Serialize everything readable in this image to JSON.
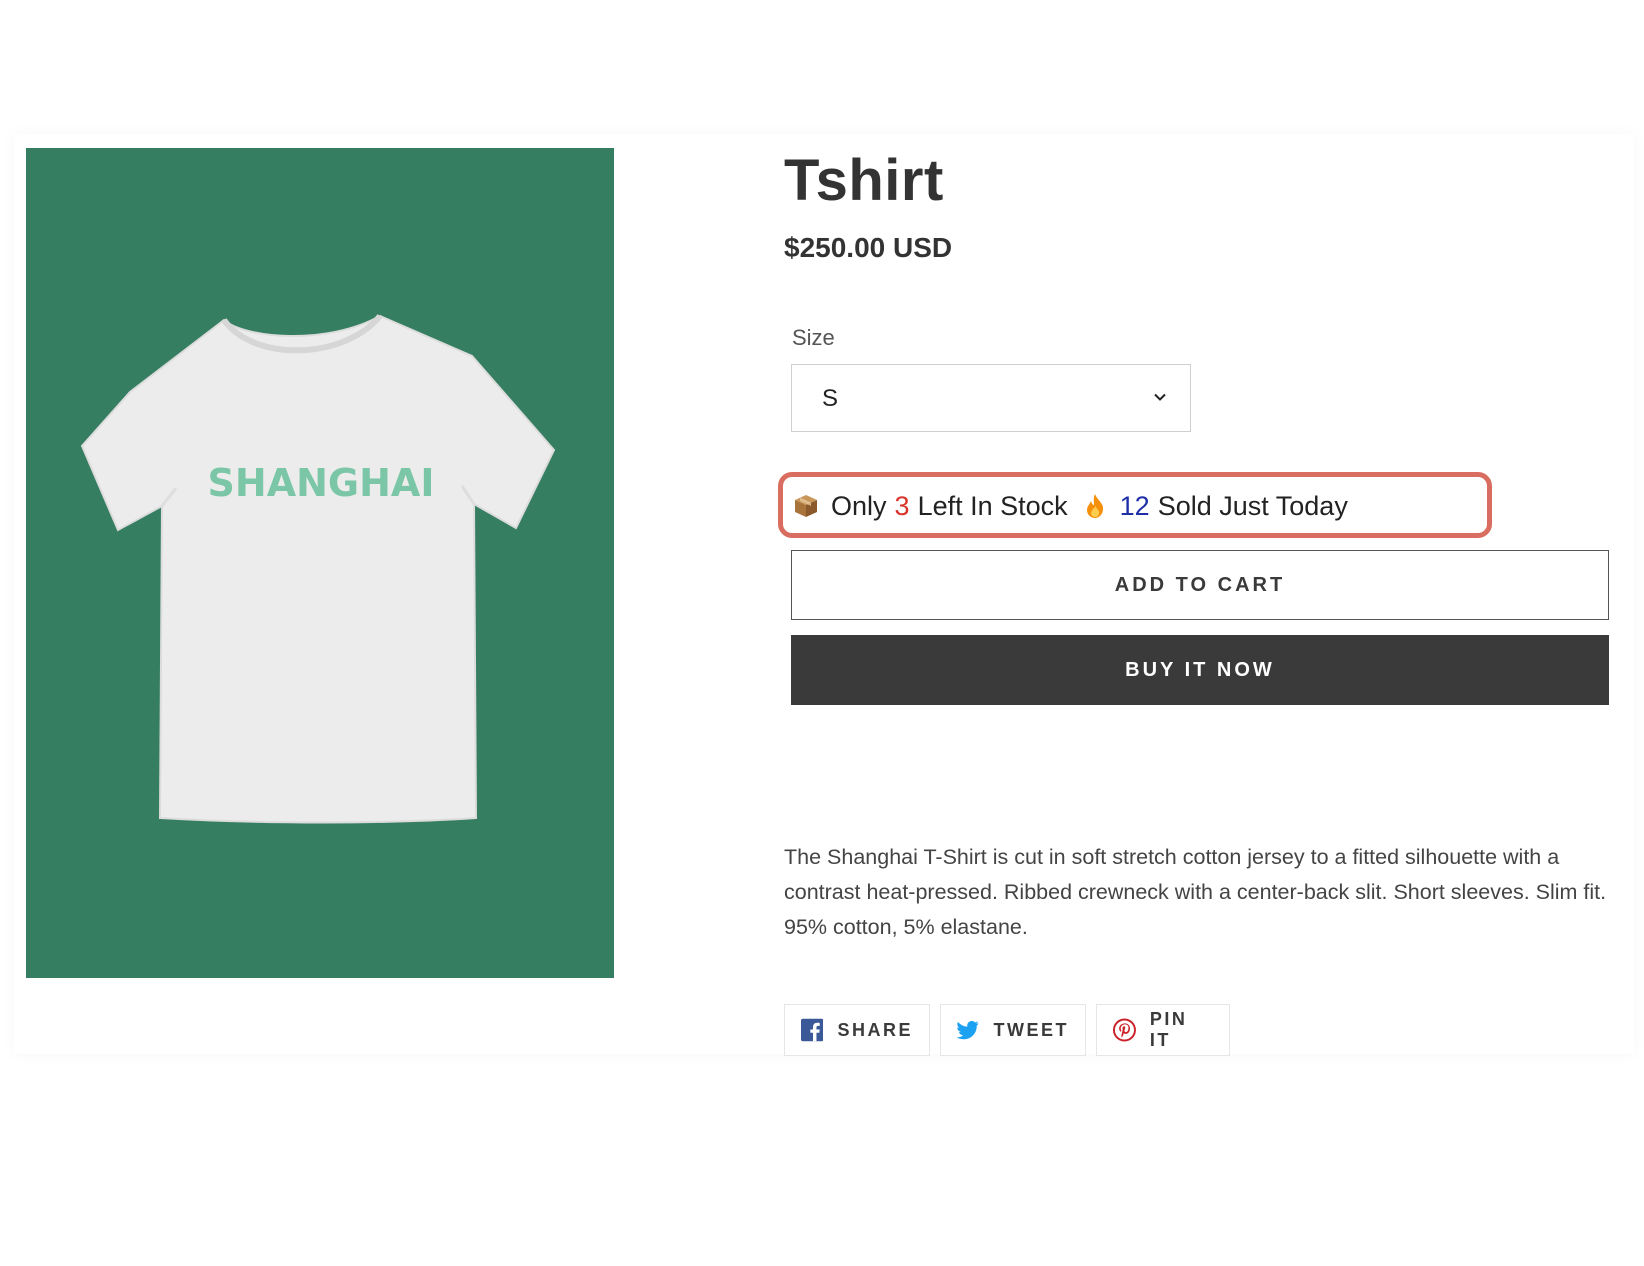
{
  "product": {
    "title": "Tshirt",
    "price": "$250.00 USD",
    "image_text": "SHANGHAI",
    "description": "The Shanghai T-Shirt is cut in soft stretch cotton jersey to a fitted silhouette with a contrast heat-pressed. Ribbed crewneck with a center-back slit. Short sleeves. Slim fit. 95% cotton, 5% elastane."
  },
  "size": {
    "label": "Size",
    "selected": "S"
  },
  "stock_banner": {
    "only": "Only",
    "left_count": "3",
    "left_text": "Left In Stock",
    "sold_count": "12",
    "sold_text": "Sold Just Today",
    "box_icon": "package-icon",
    "fire_icon": "fire-icon"
  },
  "actions": {
    "add_to_cart": "ADD TO CART",
    "buy_now": "BUY IT NOW"
  },
  "share": {
    "facebook": "SHARE",
    "twitter": "TWEET",
    "pinterest": "PIN IT"
  },
  "colors": {
    "image_background": "#367e62",
    "banner_border": "#d96d5f",
    "stock_count": "#d9342b",
    "sold_count": "#1f2fa8",
    "buy_now_background": "#3a3a3a",
    "facebook": "#3b5998",
    "twitter": "#1da1f2",
    "pinterest": "#cb2027"
  }
}
